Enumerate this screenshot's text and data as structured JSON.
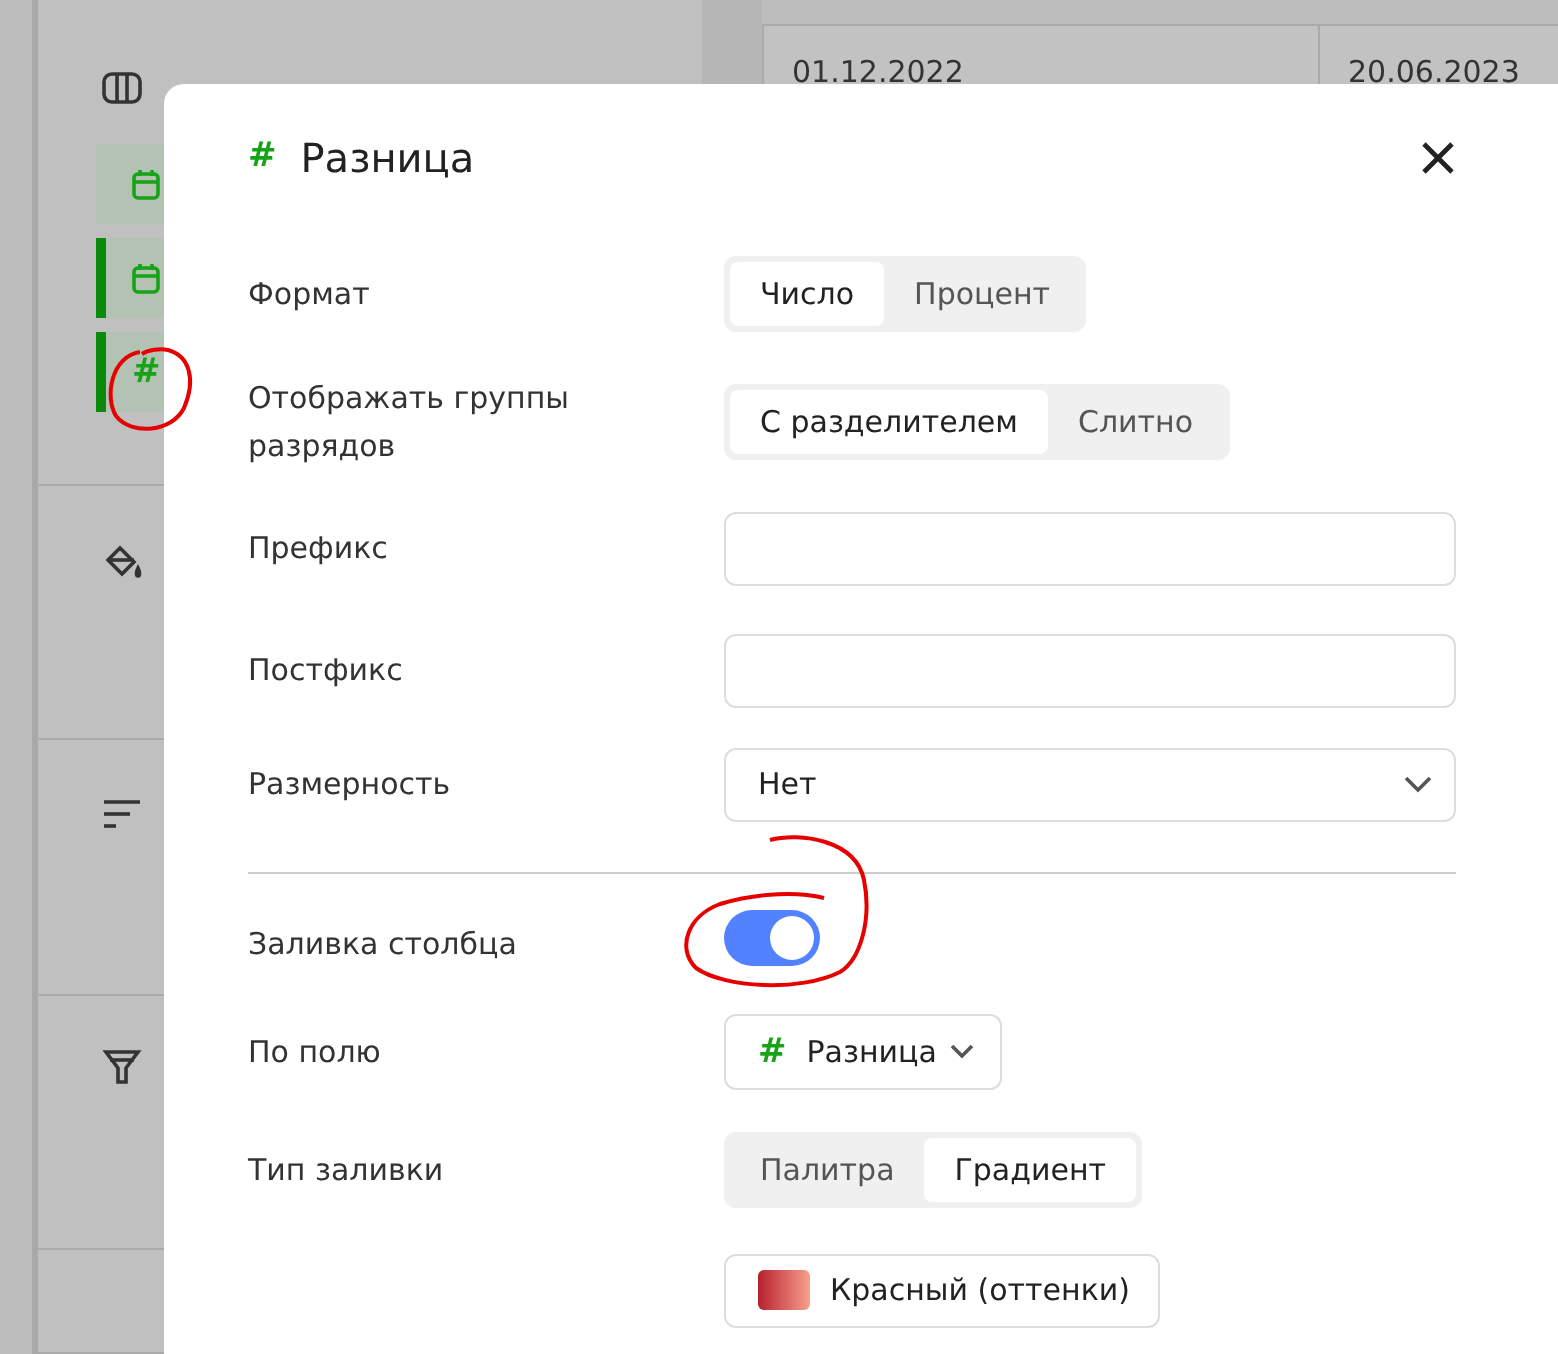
{
  "sidebar": {
    "fields": [
      {
        "kind": "date",
        "highlighted": false
      },
      {
        "kind": "date",
        "highlighted": true
      },
      {
        "kind": "number",
        "symbol": "#",
        "highlighted": true
      }
    ],
    "sections": [
      {
        "kind": "paint"
      },
      {
        "kind": "sort"
      },
      {
        "kind": "filter"
      }
    ]
  },
  "table": {
    "cells": [
      "01.12.2022",
      "20.06.2023"
    ]
  },
  "dialog": {
    "title_symbol": "#",
    "title": "Разница",
    "rows": [
      {
        "kind": "segmented",
        "label": "Формат",
        "options": [
          {
            "label": "Число",
            "selected": true
          },
          {
            "label": "Процент",
            "selected": false
          }
        ]
      },
      {
        "kind": "segmented",
        "label": "Отображать группы разрядов",
        "options": [
          {
            "label": "С разделителем",
            "selected": true
          },
          {
            "label": "Слитно",
            "selected": false
          }
        ]
      },
      {
        "kind": "input",
        "label": "Префикс"
      },
      {
        "kind": "input",
        "label": "Постфикс"
      },
      {
        "kind": "select",
        "label": "Размерность",
        "value": "Нет"
      },
      {
        "kind": "divider"
      },
      {
        "kind": "toggle",
        "label": "Заливка столбца",
        "on": true
      },
      {
        "kind": "field_select",
        "label": "По полю",
        "symbol": "#",
        "value": "Разница"
      },
      {
        "kind": "segmented",
        "label": "Тип заливки",
        "options": [
          {
            "label": "Палитра",
            "selected": false
          },
          {
            "label": "Градиент",
            "selected": true
          }
        ]
      },
      {
        "kind": "color_select",
        "value": "Красный (оттенки)"
      }
    ]
  }
}
